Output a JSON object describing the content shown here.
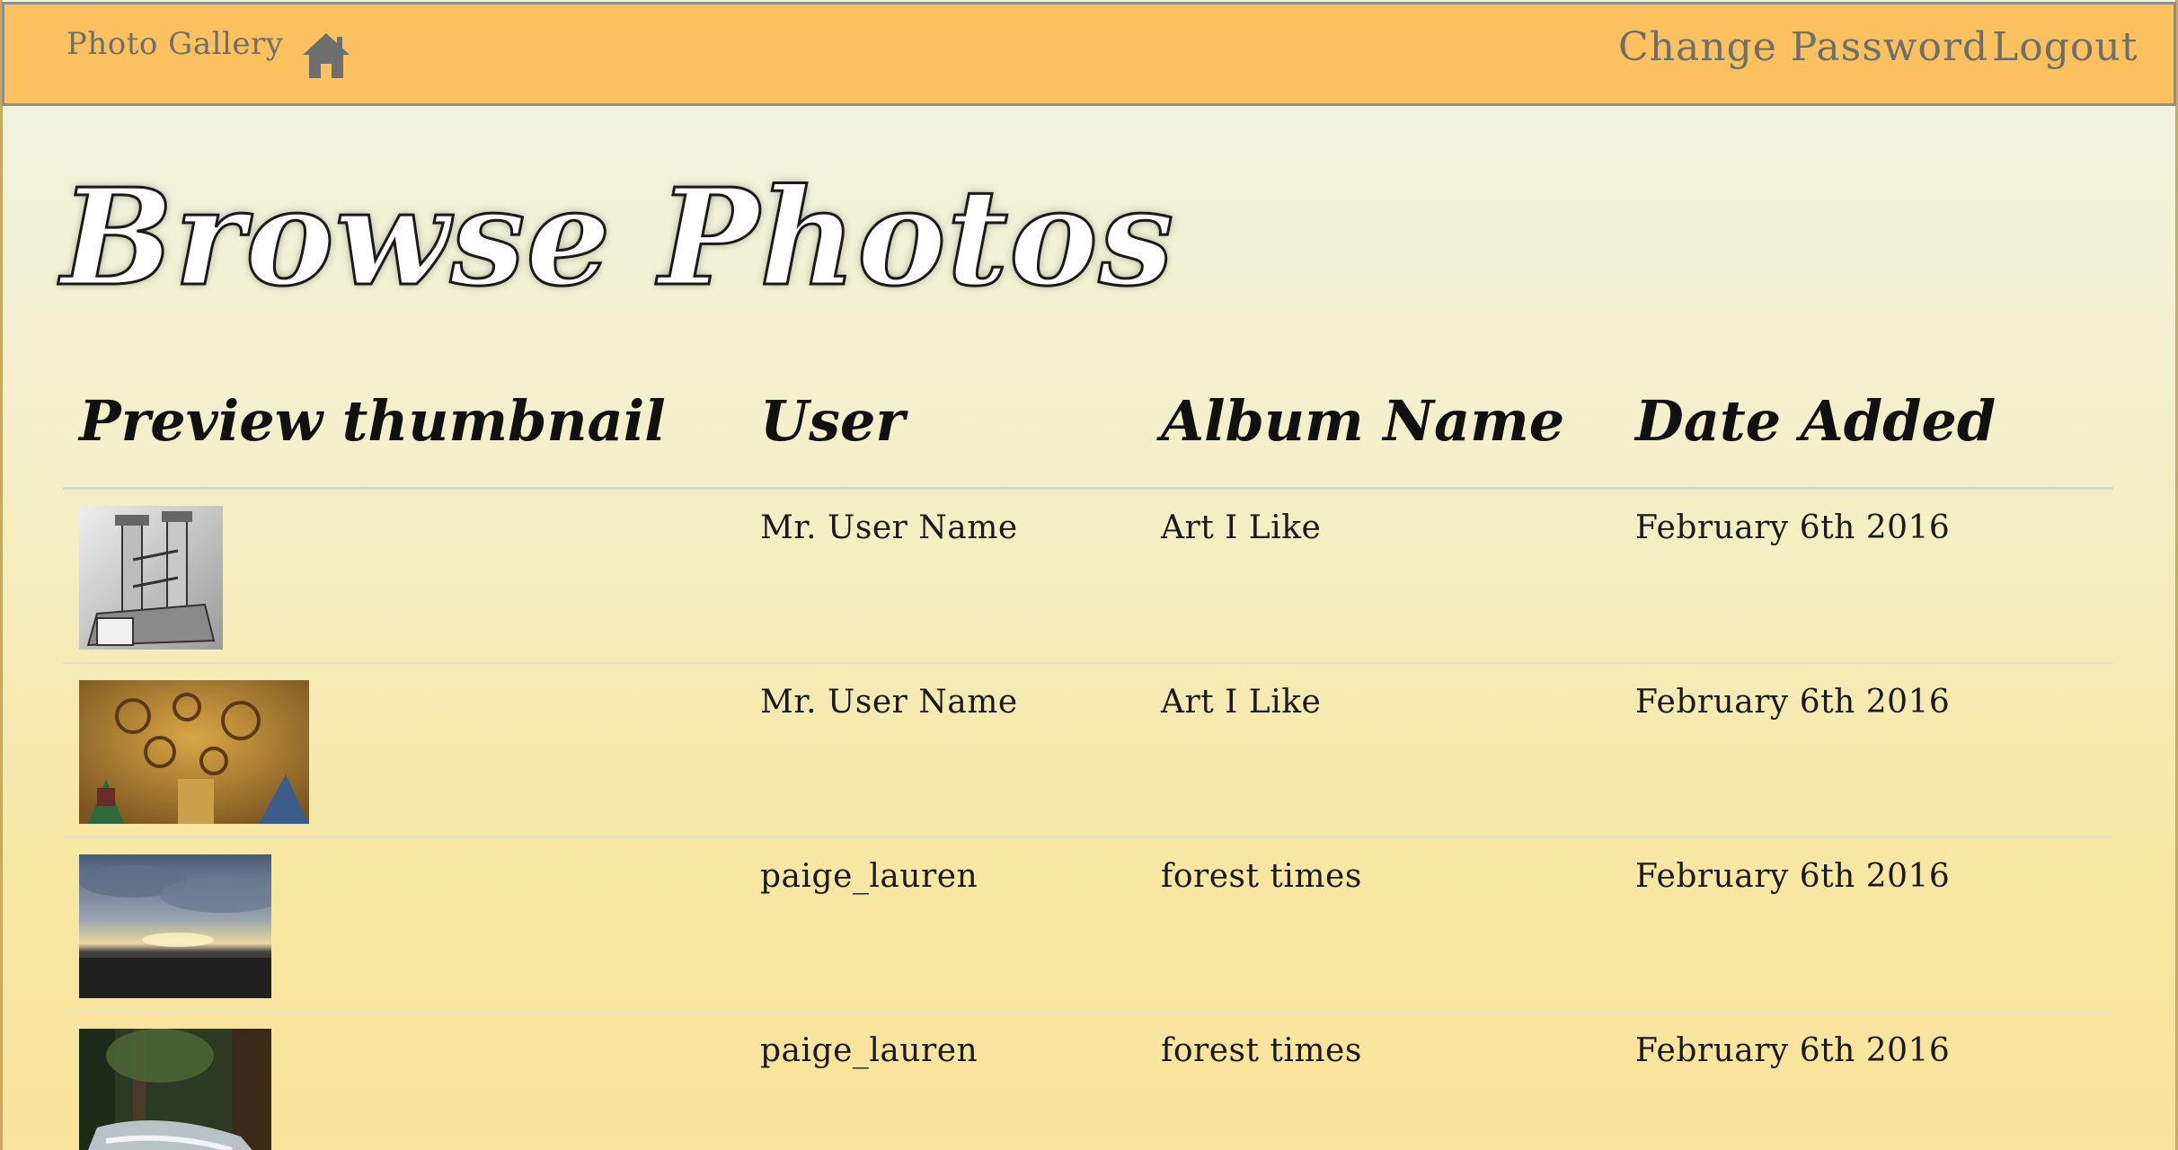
{
  "navbar": {
    "brand": "Photo Gallery",
    "home_icon": "home-icon",
    "links": [
      "Change Password",
      "Logout"
    ]
  },
  "page": {
    "title": "Browse Photos"
  },
  "table": {
    "columns": [
      "Preview thumbnail",
      "User",
      "Album Name",
      "Date Added"
    ],
    "rows": [
      {
        "thumbnail": "grayscale-tower-artwork",
        "user": "Mr. User Name",
        "album": "Art I Like",
        "date": "February 6th 2016"
      },
      {
        "thumbnail": "golden-swirl-painting",
        "user": "Mr. User Name",
        "album": "Art I Like",
        "date": "February 6th 2016"
      },
      {
        "thumbnail": "sunset-seascape-photo",
        "user": "paige_lauren",
        "album": "forest times",
        "date": "February 6th 2016"
      },
      {
        "thumbnail": "forest-stream-photo",
        "user": "paige_lauren",
        "album": "forest times",
        "date": "February 6th 2016"
      }
    ]
  },
  "colors": {
    "navbar_bg": "#fcc15f",
    "nav_text": "#6e6e6e",
    "page_bg_top": "#eef4e5",
    "page_bg_bottom": "#f9e29a"
  }
}
